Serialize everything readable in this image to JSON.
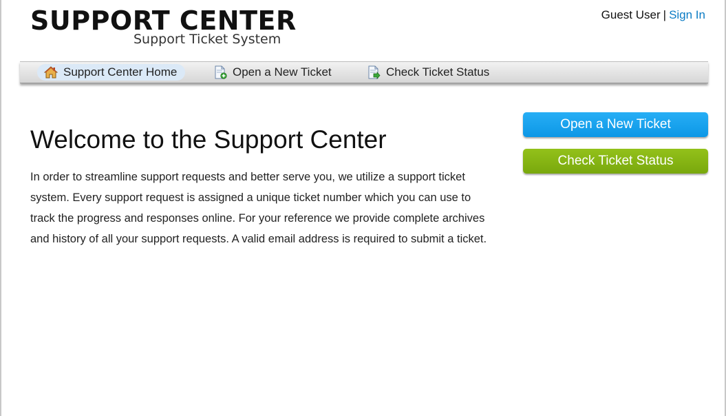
{
  "header": {
    "logo_title": "SUPPORT CENTER",
    "logo_subtitle": "Support Ticket System",
    "user_label": "Guest User",
    "separator": "|",
    "sign_in_label": "Sign In"
  },
  "nav": {
    "items": [
      {
        "label": "Support Center Home",
        "icon": "home-icon",
        "active": true
      },
      {
        "label": "Open a New Ticket",
        "icon": "new-ticket-icon",
        "active": false
      },
      {
        "label": "Check Ticket Status",
        "icon": "ticket-status-icon",
        "active": false
      }
    ]
  },
  "main": {
    "title": "Welcome to the Support Center",
    "body": "In order to streamline support requests and better serve you, we utilize a support ticket system. Every support request is assigned a unique ticket number which you can use to track the progress and responses online. For your reference we provide complete archives and history of all your support requests. A valid email address is required to submit a ticket."
  },
  "sidebar": {
    "open_ticket_label": "Open a New Ticket",
    "check_status_label": "Check Ticket Status"
  },
  "colors": {
    "link": "#0a7bc4",
    "open_button": "#1aa3ee",
    "check_button": "#86b513",
    "nav_active_bg": "#dbe9f7"
  }
}
